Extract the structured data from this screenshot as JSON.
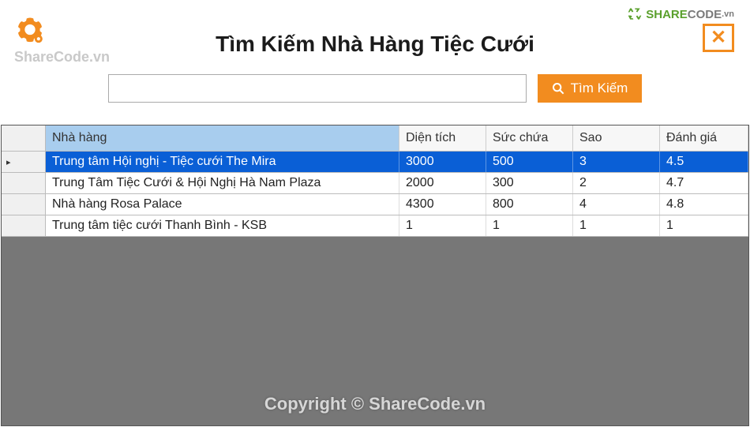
{
  "header": {
    "watermark_top": "ShareCode.vn",
    "logo_share": "SHARE",
    "logo_code": "CODE",
    "logo_vn": ".vn",
    "title": "Tìm Kiếm Nhà Hàng Tiệc Cưới"
  },
  "search": {
    "value": "",
    "button_label": "Tìm Kiếm"
  },
  "grid": {
    "columns": {
      "name": "Nhà hàng",
      "area": "Diện tích",
      "capacity": "Sức chứa",
      "star": "Sao",
      "rating": "Đánh giá"
    },
    "rows": [
      {
        "selected": true,
        "indicator": "▸",
        "name": "Trung tâm Hội nghị - Tiệc cưới The Mira",
        "area": "3000",
        "capacity": "500",
        "star": "3",
        "rating": "4.5"
      },
      {
        "selected": false,
        "indicator": "",
        "name": "Trung Tâm Tiệc Cưới & Hội Nghị Hà Nam Plaza",
        "area": "2000",
        "capacity": "300",
        "star": "2",
        "rating": "4.7"
      },
      {
        "selected": false,
        "indicator": "",
        "name": "Nhà hàng Rosa Palace",
        "area": "4300",
        "capacity": "800",
        "star": "4",
        "rating": "4.8"
      },
      {
        "selected": false,
        "indicator": "",
        "name": "Trung tâm tiệc cưới Thanh Bình - KSB",
        "area": "1",
        "capacity": "1",
        "star": "1",
        "rating": "1"
      }
    ]
  },
  "footer": {
    "watermark": "Copyright © ShareCode.vn"
  }
}
